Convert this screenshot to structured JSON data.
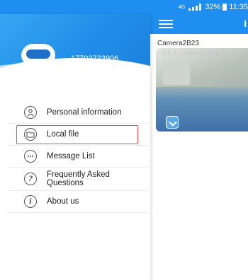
{
  "status_bar": {
    "network": "4G",
    "battery": "32%",
    "time": "11:35"
  },
  "main": {
    "header_letter": "I",
    "camera": {
      "name": "Camera2B23",
      "timestamp": "2019-11-25 11:32:18"
    }
  },
  "drawer": {
    "user_phone": "17702733906",
    "menu": [
      {
        "label": "Personal information",
        "icon": "person-icon"
      },
      {
        "label": "Local file",
        "icon": "folder-icon"
      },
      {
        "label": "Message List",
        "icon": "message-icon"
      },
      {
        "label": "Frequently Asked Questions",
        "icon": "question-icon"
      },
      {
        "label": "About us",
        "icon": "info-icon"
      }
    ],
    "highlighted_item": "Local file"
  },
  "colors": {
    "accent": "#1e8ff0",
    "highlight_border": "#e05151"
  }
}
